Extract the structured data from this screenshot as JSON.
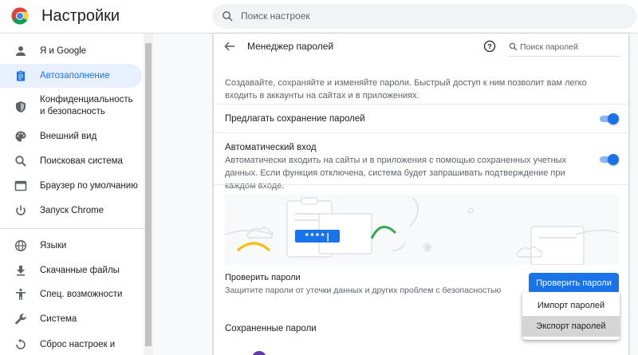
{
  "header": {
    "title": "Настройки",
    "search_placeholder": "Поиск настроек"
  },
  "sidebar": {
    "items": [
      {
        "label": "Я и Google",
        "icon": "person-icon"
      },
      {
        "label": "Автозаполнение",
        "icon": "clipboard-icon",
        "active": true
      },
      {
        "label": "Конфиденциальность и безопасность",
        "icon": "shield-icon"
      },
      {
        "label": "Внешний вид",
        "icon": "palette-icon"
      },
      {
        "label": "Поисковая система",
        "icon": "search-icon"
      },
      {
        "label": "Браузер по умолчанию",
        "icon": "browser-icon"
      },
      {
        "label": "Запуск Chrome",
        "icon": "power-icon"
      },
      {
        "label": "Языки",
        "icon": "globe-icon"
      },
      {
        "label": "Скачанные файлы",
        "icon": "download-icon"
      },
      {
        "label": "Спец. возможности",
        "icon": "accessibility-icon"
      },
      {
        "label": "Система",
        "icon": "wrench-icon"
      },
      {
        "label": "Сброс настроек и",
        "icon": "reset-icon"
      }
    ]
  },
  "passwords": {
    "title": "Менеджер паролей",
    "search_placeholder": "Поиск паролей",
    "description": "Создавайте, сохраняйте и изменяйте пароли. Быстрый доступ к ним позволит вам легко входить в аккаунты на сайтах и в приложениях.",
    "offer_save_label": "Предлагать сохранение паролей",
    "offer_save_on": true,
    "auto_signin_label": "Автоматический вход",
    "auto_signin_desc": "Автоматически входить на сайты и в приложения с помощью сохраненных учетных данных. Если функция отключена, система будет запрашивать подтверждение при каждом входе.",
    "auto_signin_on": true,
    "illustration_text": "****|",
    "check_title": "Проверить пароли",
    "check_desc": "Защитите пароли от утечки данных и других проблем с безопасностью",
    "check_button": "Проверить пароли",
    "saved_title": "Сохраненные пароли"
  },
  "menu": {
    "items": [
      "Импорт паролей",
      "Экспорт паролей"
    ],
    "hovered_index": 1
  },
  "colors": {
    "accent": "#1a73e8",
    "active_bg": "#e8f0fe",
    "toggle_track": "#8ab4f8"
  }
}
